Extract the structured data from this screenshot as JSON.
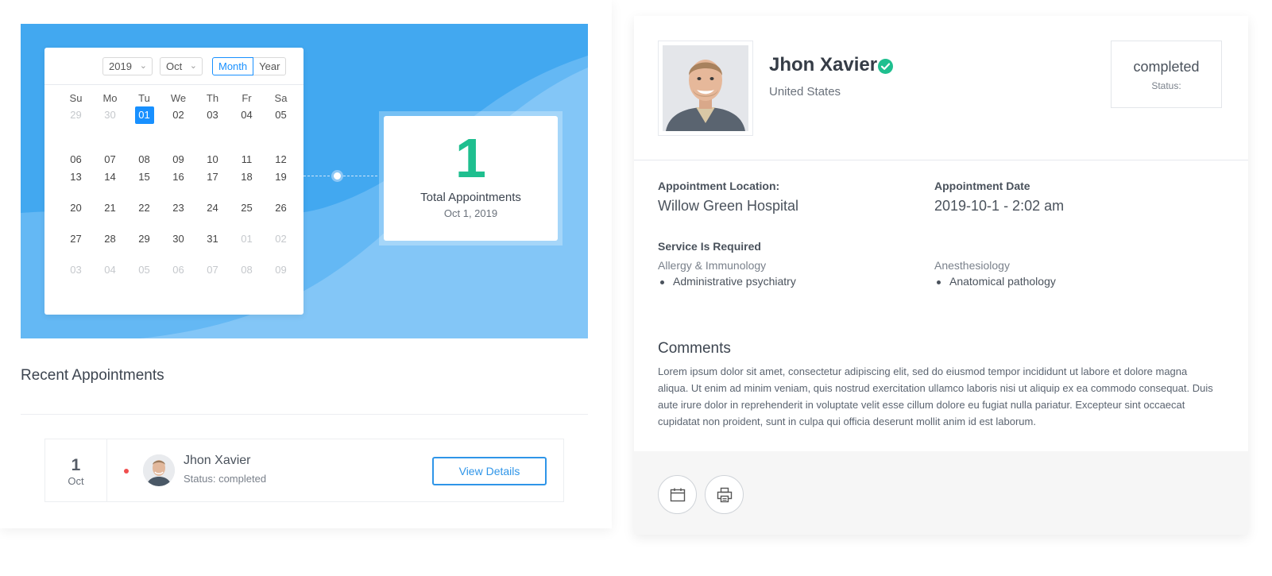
{
  "calendar": {
    "year": "2019",
    "month": "Oct",
    "mode_month": "Month",
    "mode_year": "Year",
    "weekdays": [
      "Su",
      "Mo",
      "Tu",
      "We",
      "Th",
      "Fr",
      "Sa"
    ],
    "weeks": [
      [
        "29",
        "30",
        "01",
        "02",
        "03",
        "04",
        "05"
      ],
      [
        "06",
        "07",
        "08",
        "09",
        "10",
        "11",
        "12"
      ],
      [
        "13",
        "14",
        "15",
        "16",
        "17",
        "18",
        "19"
      ],
      [
        "20",
        "21",
        "22",
        "23",
        "24",
        "25",
        "26"
      ],
      [
        "27",
        "28",
        "29",
        "30",
        "31",
        "01",
        "02"
      ],
      [
        "03",
        "04",
        "05",
        "06",
        "07",
        "08",
        "09"
      ]
    ],
    "selected_day": "01"
  },
  "summary": {
    "count": "1",
    "label": "Total Appointments",
    "date": "Oct 1, 2019"
  },
  "recent": {
    "title": "Recent Appointments",
    "items": [
      {
        "day": "1",
        "month": "Oct",
        "name": "Jhon Xavier",
        "status": "Status: completed",
        "button": "View Details"
      }
    ]
  },
  "detail": {
    "name": "Jhon Xavier",
    "country": "United States",
    "status_value": "completed",
    "status_label": "Status:",
    "location_label": "Appointment Location:",
    "location_value": "Willow Green Hospital",
    "date_label": "Appointment Date",
    "date_value": "2019-10-1 - 2:02 am",
    "services_label": "Service Is Required",
    "services": [
      {
        "name": "Allergy & Immunology",
        "item": "Administrative psychiatry"
      },
      {
        "name": "Anesthesiology",
        "item": "Anatomical pathology"
      }
    ],
    "comments_title": "Comments",
    "comments_text": "Lorem ipsum dolor sit amet, consectetur adipiscing elit, sed do eiusmod tempor incididunt ut labore et dolore magna aliqua. Ut enim ad minim veniam, quis nostrud exercitation ullamco laboris nisi ut aliquip ex ea commodo consequat. Duis aute irure dolor in reprehenderit in voluptate velit esse cillum dolore eu fugiat nulla pariatur. Excepteur sint occaecat cupidatat non proident, sunt in culpa qui officia deserunt mollit anim id est laborum."
  },
  "icons": {
    "verified": "check-circle-icon",
    "calendar": "calendar-icon",
    "print": "printer-icon"
  },
  "colors": {
    "hero_blue": "#42a8f0",
    "accent_green": "#1fbf8f",
    "link_blue": "#2f95e8",
    "selected_blue": "#1890ff",
    "status_dot": "#f04e4e"
  }
}
